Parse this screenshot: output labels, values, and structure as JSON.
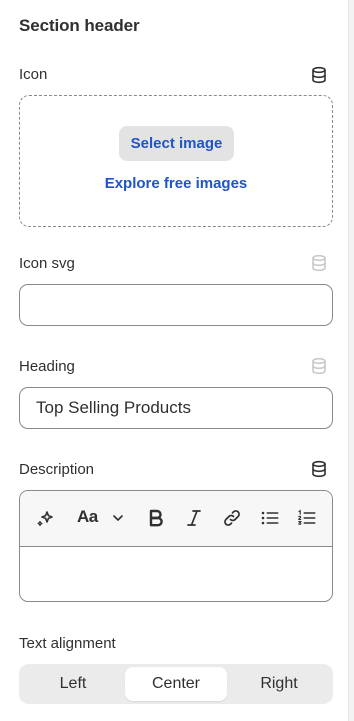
{
  "panel": {
    "section_title": "Section header"
  },
  "icon_field": {
    "label": "Icon",
    "select_label": "Select image",
    "explore_label": "Explore free images"
  },
  "icon_svg_field": {
    "label": "Icon svg",
    "value": ""
  },
  "heading_field": {
    "label": "Heading",
    "value": "Top Selling Products"
  },
  "description_field": {
    "label": "Description",
    "value": "",
    "toolbar": {
      "text_style_label": "Aa"
    }
  },
  "alignment_field": {
    "label": "Text alignment",
    "options": [
      "Left",
      "Center",
      "Right"
    ],
    "selected": "Center"
  },
  "colors": {
    "link": "#1f55c4",
    "text": "#303030",
    "border": "#8a8a8a"
  },
  "icons": [
    "dynamic-source-icon",
    "magic-icon",
    "chevron-down-icon",
    "bold-icon",
    "italic-icon",
    "link-icon",
    "bullet-list-icon",
    "numbered-list-icon"
  ]
}
